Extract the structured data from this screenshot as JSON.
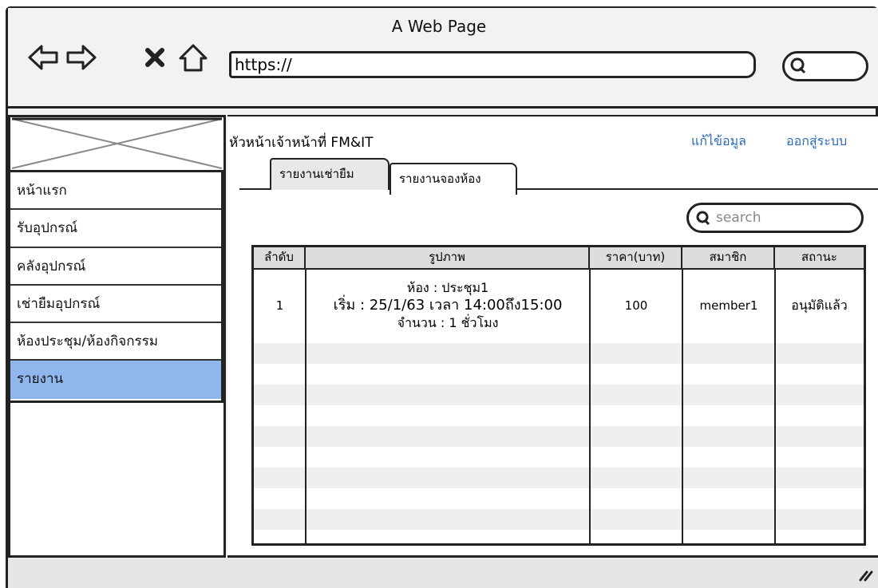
{
  "window": {
    "title": "A Web Page"
  },
  "address_bar": {
    "url": "https://"
  },
  "header": {
    "user_title": "หัวหน้าเจ้าหน้าที่ FM&IT",
    "edit_link": "แก้ไข้อมูล",
    "logout_link": "ออกสู่ระบบ"
  },
  "tabs": [
    {
      "label": "รายงานเช่ายืม"
    },
    {
      "label": "รายงานจองห้อง"
    }
  ],
  "sidebar": {
    "items": [
      {
        "label": "หน้าแรก"
      },
      {
        "label": "รับอุปกรณ์"
      },
      {
        "label": "คลังอุปกรณ์"
      },
      {
        "label": "เช่ายืมอุปกรณ์"
      },
      {
        "label": "ห้องประชุม/ห้องกิจกรรม"
      },
      {
        "label": "รายงาน"
      }
    ]
  },
  "search": {
    "placeholder": "search"
  },
  "table": {
    "headers": [
      "ลำดับ",
      "รูปภาพ",
      "ราคา(บาท)",
      "สมาชิก",
      "สถานะ"
    ],
    "rows": [
      {
        "no": "1",
        "detail_line1": "ห้อง : ประชุม1",
        "detail_line2": "เริ่ม : 25/1/63 เวลา 14:00ถึง15:00",
        "detail_line3": "จำนวน : 1 ชั่วโมง",
        "price": "100",
        "member": "member1",
        "status": "อนุมัติแล้ว"
      }
    ]
  },
  "colors": {
    "active_nav": "#8fb7ee",
    "link": "#2a6bb8"
  }
}
